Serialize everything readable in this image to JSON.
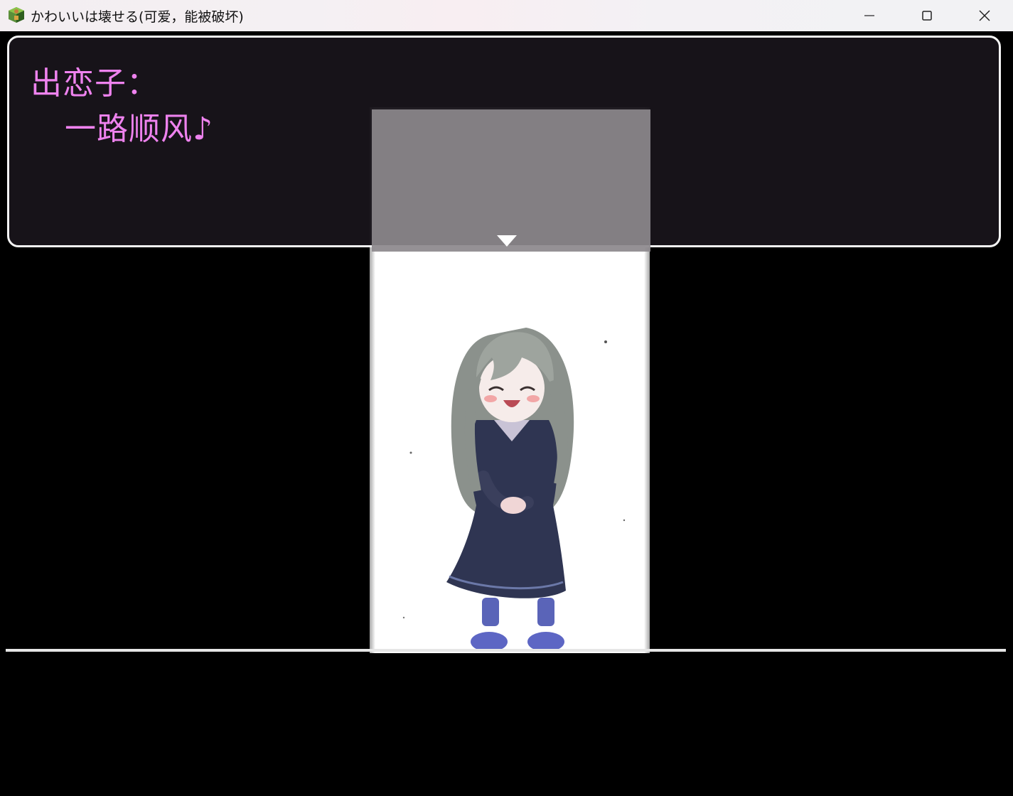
{
  "window": {
    "title": "かわいいは壊せる(可爱，能被破坏)",
    "icon": "rpg-maker-app-icon",
    "controls": {
      "minimize": "minimize-icon",
      "maximize": "maximize-icon",
      "close": "close-icon"
    }
  },
  "dialog": {
    "speaker": "出恋子：",
    "line": "一路顺风♪",
    "text_color": "#ee82ee",
    "advance_indicator": "triangle-down-icon"
  },
  "scene": {
    "character": "smiling girl with long hair in dark navy dress and blue socks"
  }
}
